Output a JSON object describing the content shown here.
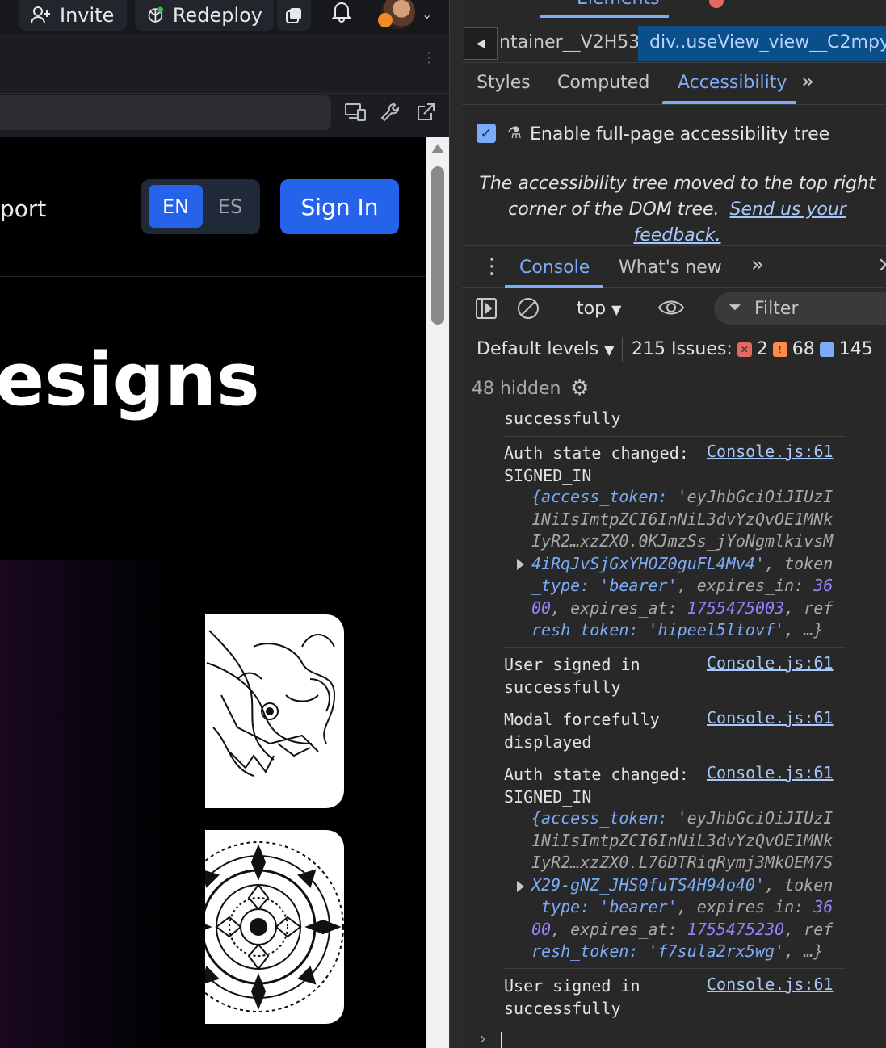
{
  "topbar": {
    "invite": "Invite",
    "redeploy": "Redeploy"
  },
  "site": {
    "nav_partial": "port",
    "lang": [
      "EN",
      "ES"
    ],
    "signin": "Sign In",
    "hero_partial": "esigns"
  },
  "devtools": {
    "top_tab": "Elements",
    "breadcrumbs": [
      "ntainer__V2H53",
      "div..useView_view__C2mpy"
    ],
    "panel_tabs": [
      "Styles",
      "Computed",
      "Accessibility"
    ],
    "a11y_checkbox": "Enable full-page accessibility tree",
    "a11y_note": "The accessibility tree moved to the top right corner of the DOM tree.",
    "a11y_feedback": "Send us your feedback.",
    "drawer_tabs": [
      "Console",
      "What's new"
    ],
    "context": "top",
    "filter_placeholder": "Filter",
    "levels": "Default levels",
    "issues_label": "215 Issues:",
    "issues_err": "2",
    "issues_warn": "68",
    "issues_info": "145",
    "hidden": "48 hidden",
    "console_lines": [
      {
        "text": "successfully",
        "src": ""
      },
      {
        "text": "Auth state changed: SIGNED_IN",
        "src": "Console.js:61",
        "obj": {
          "l1": "{access_token: 'eyJhbGciOiJIUzI",
          "l2": "1NiIsImtpZCI6InNiL3dvYzQvOE1MNk",
          "l3": "IyR2…xzZX0.0KJmzSs_jYoNgmlkivsM",
          "l4": "4iRqJvSjGxYHOZ0guFL4Mv4', token",
          "l5": "_type: 'bearer', expires_in: 36",
          "l6": "00, expires_at: 1755475003, ref",
          "l7": "resh_token: 'hipeel5ltovf', …}"
        }
      },
      {
        "text": "User signed in successfully",
        "src": "Console.js:61"
      },
      {
        "text": "Modal forcefully displayed",
        "src": "Console.js:61"
      },
      {
        "text": "Auth state changed: SIGNED_IN",
        "src": "Console.js:61",
        "obj": {
          "l1": "{access_token: 'eyJhbGciOiJIUzI",
          "l2": "1NiIsImtpZCI6InNiL3dvYzQvOE1MNk",
          "l3": "IyR2…xzZX0.L76DTRiqRymj3MkOEM7S",
          "l4": "X29-gNZ_JHS0fuTS4H94o40', token",
          "l5": "_type: 'bearer', expires_in: 36",
          "l6": "00, expires_at: 1755475230, ref",
          "l7": "resh_token: 'f7sula2rx5wg', …}"
        }
      },
      {
        "text": "User signed in successfully",
        "src": "Console.js:61"
      }
    ]
  }
}
